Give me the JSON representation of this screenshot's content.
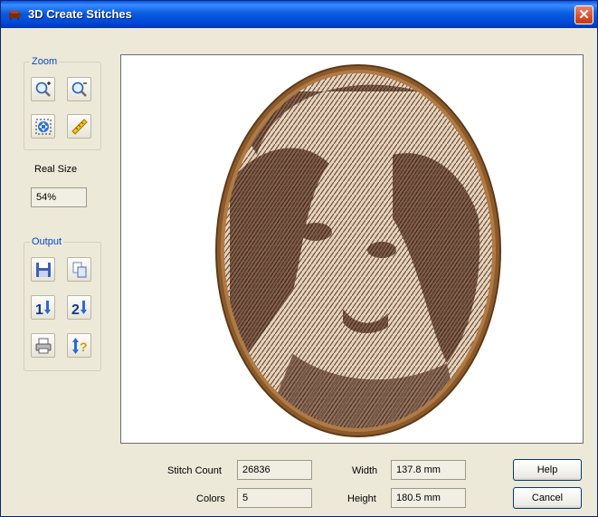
{
  "window": {
    "title": "3D Create Stitches",
    "close_symbol": "✕"
  },
  "zoom_group": {
    "label": "Zoom",
    "tools": [
      {
        "icon": "zoom-in-icon"
      },
      {
        "icon": "zoom-out-icon"
      },
      {
        "icon": "fit-to-window-icon"
      },
      {
        "icon": "measure-ruler-icon"
      }
    ]
  },
  "real_size": {
    "label": "Real Size",
    "value": "54%"
  },
  "output_group": {
    "label": "Output",
    "tools": [
      {
        "icon": "save-icon"
      },
      {
        "icon": "copy-icon"
      },
      {
        "icon": "export-1-icon",
        "digit": "1"
      },
      {
        "icon": "export-2-icon",
        "digit": "2"
      },
      {
        "icon": "print-icon"
      },
      {
        "icon": "sort-help-icon"
      }
    ]
  },
  "stats": {
    "stitch_count_label": "Stitch Count",
    "stitch_count": "26836",
    "colors_label": "Colors",
    "colors": "5",
    "width_label": "Width",
    "width": "137.8 mm",
    "height_label": "Height",
    "height": "180.5 mm"
  },
  "buttons": {
    "help": "Help",
    "cancel": "Cancel"
  },
  "colors": {
    "frame_brown": "#8b5a2b",
    "stitch_dark": "#5e4030",
    "stitch_light": "#e8d8c4",
    "title_blue": "#0058ee"
  }
}
